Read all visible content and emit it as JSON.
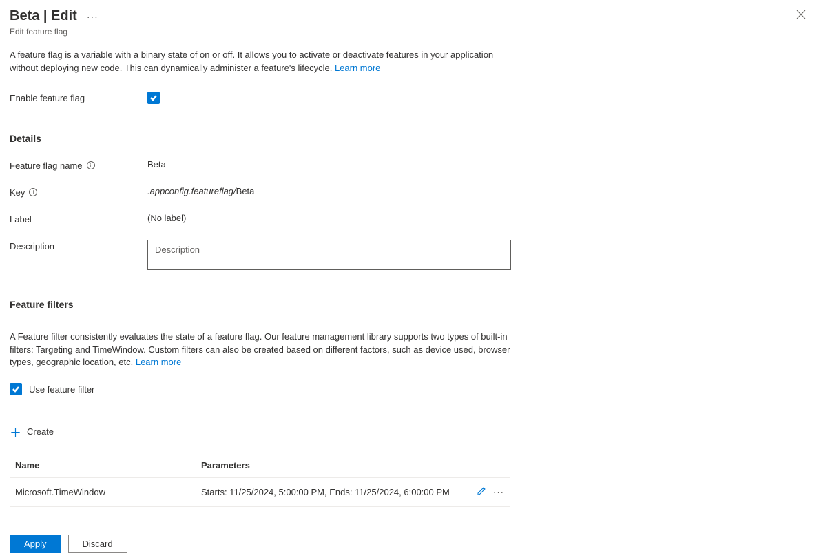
{
  "header": {
    "title": "Beta | Edit",
    "subtitle": "Edit feature flag"
  },
  "intro": {
    "text": "A feature flag is a variable with a binary state of on or off. It allows you to activate or deactivate features in your application without deploying new code. This can dynamically administer a feature's lifecycle. ",
    "learn_more": "Learn more"
  },
  "enable": {
    "label": "Enable feature flag"
  },
  "details": {
    "heading": "Details",
    "name_label": "Feature flag name",
    "name_value": "Beta",
    "key_label": "Key",
    "key_prefix": ".appconfig.featureflag/",
    "key_value": "Beta",
    "label_label": "Label",
    "label_value": "(No label)",
    "description_label": "Description",
    "description_placeholder": "Description"
  },
  "filters": {
    "heading": "Feature filters",
    "intro": "A Feature filter consistently evaluates the state of a feature flag. Our feature management library supports two types of built-in filters: Targeting and TimeWindow. Custom filters can also be created based on different factors, such as device used, browser types, geographic location, etc. ",
    "learn_more": "Learn more",
    "use_filter_label": "Use feature filter",
    "create_label": "Create",
    "table": {
      "col_name": "Name",
      "col_params": "Parameters",
      "rows": [
        {
          "name": "Microsoft.TimeWindow",
          "params": "Starts: 11/25/2024, 5:00:00 PM, Ends: 11/25/2024, 6:00:00 PM"
        }
      ]
    }
  },
  "footer": {
    "apply": "Apply",
    "discard": "Discard"
  }
}
